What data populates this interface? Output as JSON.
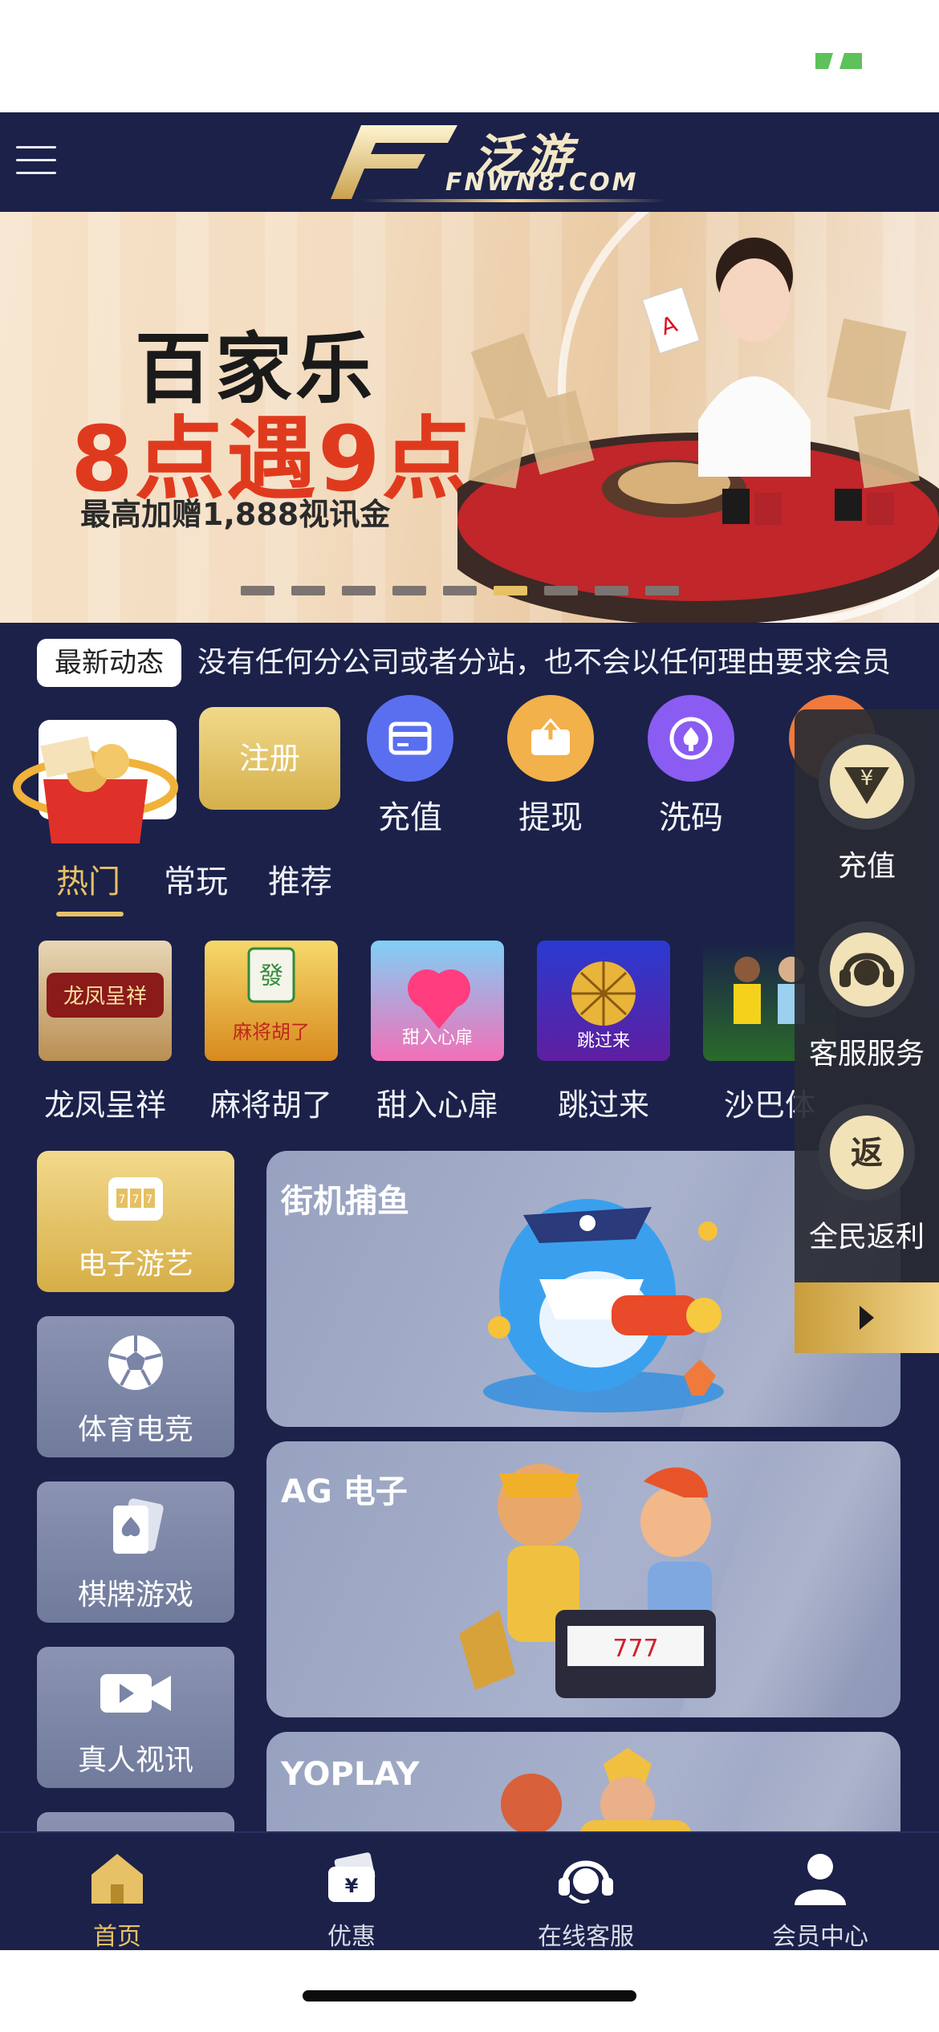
{
  "header": {
    "logo_cn": "泛游",
    "logo_en": "FNWN8.COM"
  },
  "banner": {
    "title": "百家乐",
    "subtitle": "8点遇9点",
    "promo": "最高加赠1,888视讯金",
    "slide_count": 9,
    "active_slide": 6
  },
  "news": {
    "tag": "最新动态",
    "text": "没有任何分公司或者分站，也不会以任何理由要求会员"
  },
  "actions": {
    "register": "注册",
    "items": [
      {
        "label": "充值",
        "icon": "card-icon",
        "color": "#5a6ff0"
      },
      {
        "label": "提现",
        "icon": "withdraw-icon",
        "color": "#f2b14a"
      },
      {
        "label": "洗码",
        "icon": "chip-icon",
        "color": "#8a5cf2"
      }
    ]
  },
  "tabs": {
    "items": [
      "热门",
      "常玩",
      "推荐"
    ],
    "active": 0
  },
  "games": [
    {
      "name": "龙凤呈祥"
    },
    {
      "name": "麻将胡了"
    },
    {
      "name": "甜入心扉"
    },
    {
      "name": "跳过来"
    },
    {
      "name": "沙巴体"
    }
  ],
  "categories": [
    {
      "label": "电子游艺",
      "icon": "slot-machine-icon",
      "active": true
    },
    {
      "label": "体育电竞",
      "icon": "soccer-ball-icon",
      "active": false
    },
    {
      "label": "棋牌游戏",
      "icon": "cards-icon",
      "active": false
    },
    {
      "label": "真人视讯",
      "icon": "video-camera-icon",
      "active": false
    }
  ],
  "cards": [
    {
      "title": "街机捕鱼"
    },
    {
      "title": "AG 电子"
    },
    {
      "title": "YOPLAY"
    }
  ],
  "float_panel": {
    "items": [
      {
        "label": "充值",
        "icon": "yen-down-icon"
      },
      {
        "label": "客服服务",
        "icon": "headset-icon"
      },
      {
        "label": "全民返利",
        "icon": "rebate-icon"
      }
    ]
  },
  "bottom_nav": {
    "items": [
      {
        "label": "首页",
        "icon": "home-icon"
      },
      {
        "label": "优惠",
        "icon": "wallet-icon"
      },
      {
        "label": "在线客服",
        "icon": "headset-icon"
      },
      {
        "label": "会员中心",
        "icon": "user-icon"
      }
    ],
    "active": 0
  },
  "colors": {
    "navy": "#1b2149",
    "gold": "#e7c165"
  }
}
